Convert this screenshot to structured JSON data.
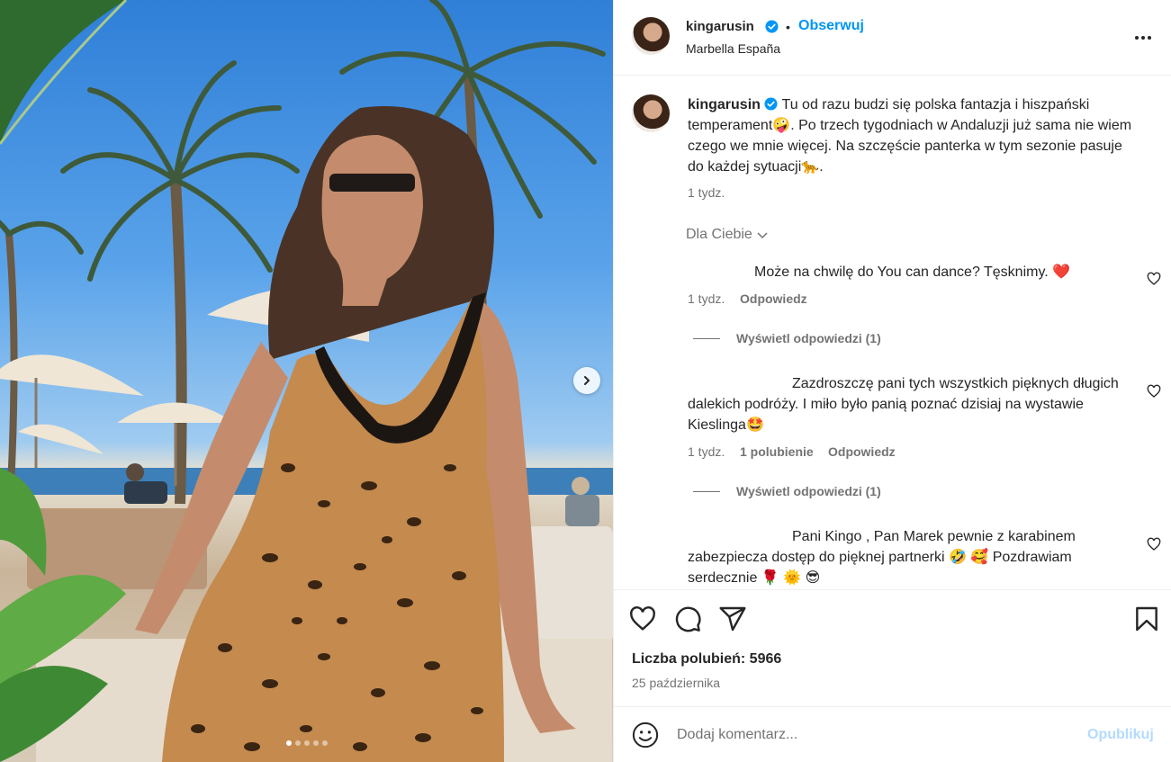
{
  "post": {
    "username": "kingarusin",
    "separator": "•",
    "follow_label": "Obserwuj",
    "location": "Marbella España",
    "more_icon": "more-horizontal-icon"
  },
  "caption": {
    "username": "kingarusin",
    "text_1": "Tu od razu budzi się polska fantazja i hiszpański temperament",
    "emoji_1": "🤪",
    "text_2": ". Po trzech tygodniach w Andaluzji już sama nie wiem czego we mnie więcej. Na szczęście panterka w tym sezonie pasuje do każdej sytuacji",
    "emoji_2": "🐆",
    "text_3": ".",
    "time": "1 tydz."
  },
  "for_you_label": "Dla Ciebie",
  "comments": [
    {
      "text": "Może na chwilę do You can dance? Tęsknimy. ",
      "emoji": "❤️",
      "time": "1 tydz.",
      "reply": "Odpowiedz",
      "view_replies": "Wyświetl odpowiedzi (1)"
    },
    {
      "text": "Zazdroszczę pani tych wszystkich pięknych długich dalekich podróży. I miło było panią poznać dzisiaj na wystawie Kieslinga",
      "emoji": "🤩",
      "time": "1 tydz.",
      "likes": "1 polubienie",
      "reply": "Odpowiedz",
      "view_replies": "Wyświetl odpowiedzi (1)"
    },
    {
      "text": "Pani Kingo , Pan Marek pewnie z karabinem zabezpiecza dostęp do pięknej partnerki",
      "emoji": "🤣 🥰",
      "text_2": "Pozdrawiam serdecznie",
      "emoji_2": "🌹 🌞 😎"
    }
  ],
  "actions": {
    "icons": [
      "heart-icon",
      "comment-icon",
      "share-icon",
      "bookmark-icon"
    ]
  },
  "likes_label": "Liczba polubień: 5966",
  "date": "25 października",
  "add_comment": {
    "placeholder": "Dodaj komentarz...",
    "publish_label": "Opublikuj"
  },
  "colors": {
    "accent": "#0095f6",
    "publish_disabled": "#b3dbff",
    "muted_text": "#737373",
    "like_red": "#ed4956"
  },
  "carousel": {
    "slide_count": 5,
    "active_slide": 1
  }
}
